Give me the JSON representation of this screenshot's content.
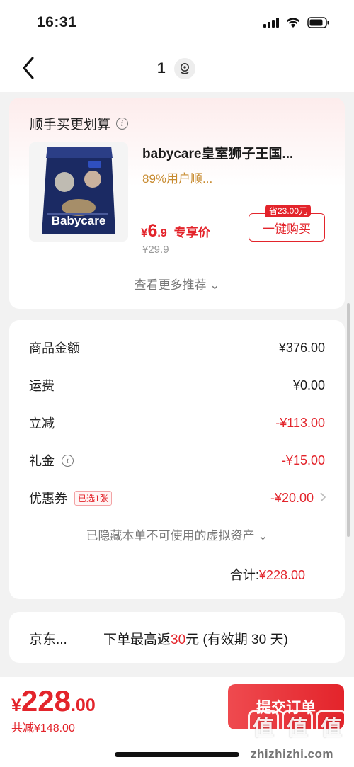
{
  "status_bar": {
    "time": "16:31"
  },
  "nav": {
    "title": "1"
  },
  "recommend": {
    "title": "顺手买更划算",
    "product_name": "babycare皇室狮子王国...",
    "tag": "89%用户顺...",
    "price_yen": "¥",
    "price_int": "6",
    "price_dec": ".9",
    "price_label": "专享价",
    "original_price": "¥29.9",
    "save_badge": "省23.00元",
    "buy_label": "一键购买",
    "more_label": "查看更多推荐 ⌄",
    "image_brand": "Babycare"
  },
  "summary": {
    "rows": [
      {
        "label": "商品金额",
        "value": "¥376.00"
      },
      {
        "label": "运费",
        "value": "¥0.00"
      },
      {
        "label": "立减",
        "value": "-¥113.00"
      },
      {
        "label": "礼金",
        "value": "-¥15.00"
      },
      {
        "label": "优惠券",
        "value": "-¥20.00",
        "chip": "已选1张"
      }
    ],
    "hidden_assets": "已隐藏本单不可使用的虚拟资产 ⌄",
    "total_label": "合计:",
    "total_value": "¥228.00"
  },
  "rebate": {
    "left": "京东...",
    "right_prefix": "下单最高返",
    "right_num": "30",
    "right_suffix": "元 (有效期 30 天)"
  },
  "bottom": {
    "price_yen": "¥",
    "price_int": "228",
    "price_dec": ".00",
    "saved": "共减¥148.00",
    "submit_label": "提交订单"
  },
  "watermark": {
    "glyph": "值",
    "text": "zhizhizhi.com"
  },
  "colors": {
    "accent": "#e3242b",
    "tag": "#c78a2e",
    "muted": "#999999"
  },
  "icons": [
    "back-icon",
    "location-icon",
    "info-icon",
    "chevron-right-icon",
    "signal-icon",
    "wifi-icon",
    "battery-icon"
  ]
}
